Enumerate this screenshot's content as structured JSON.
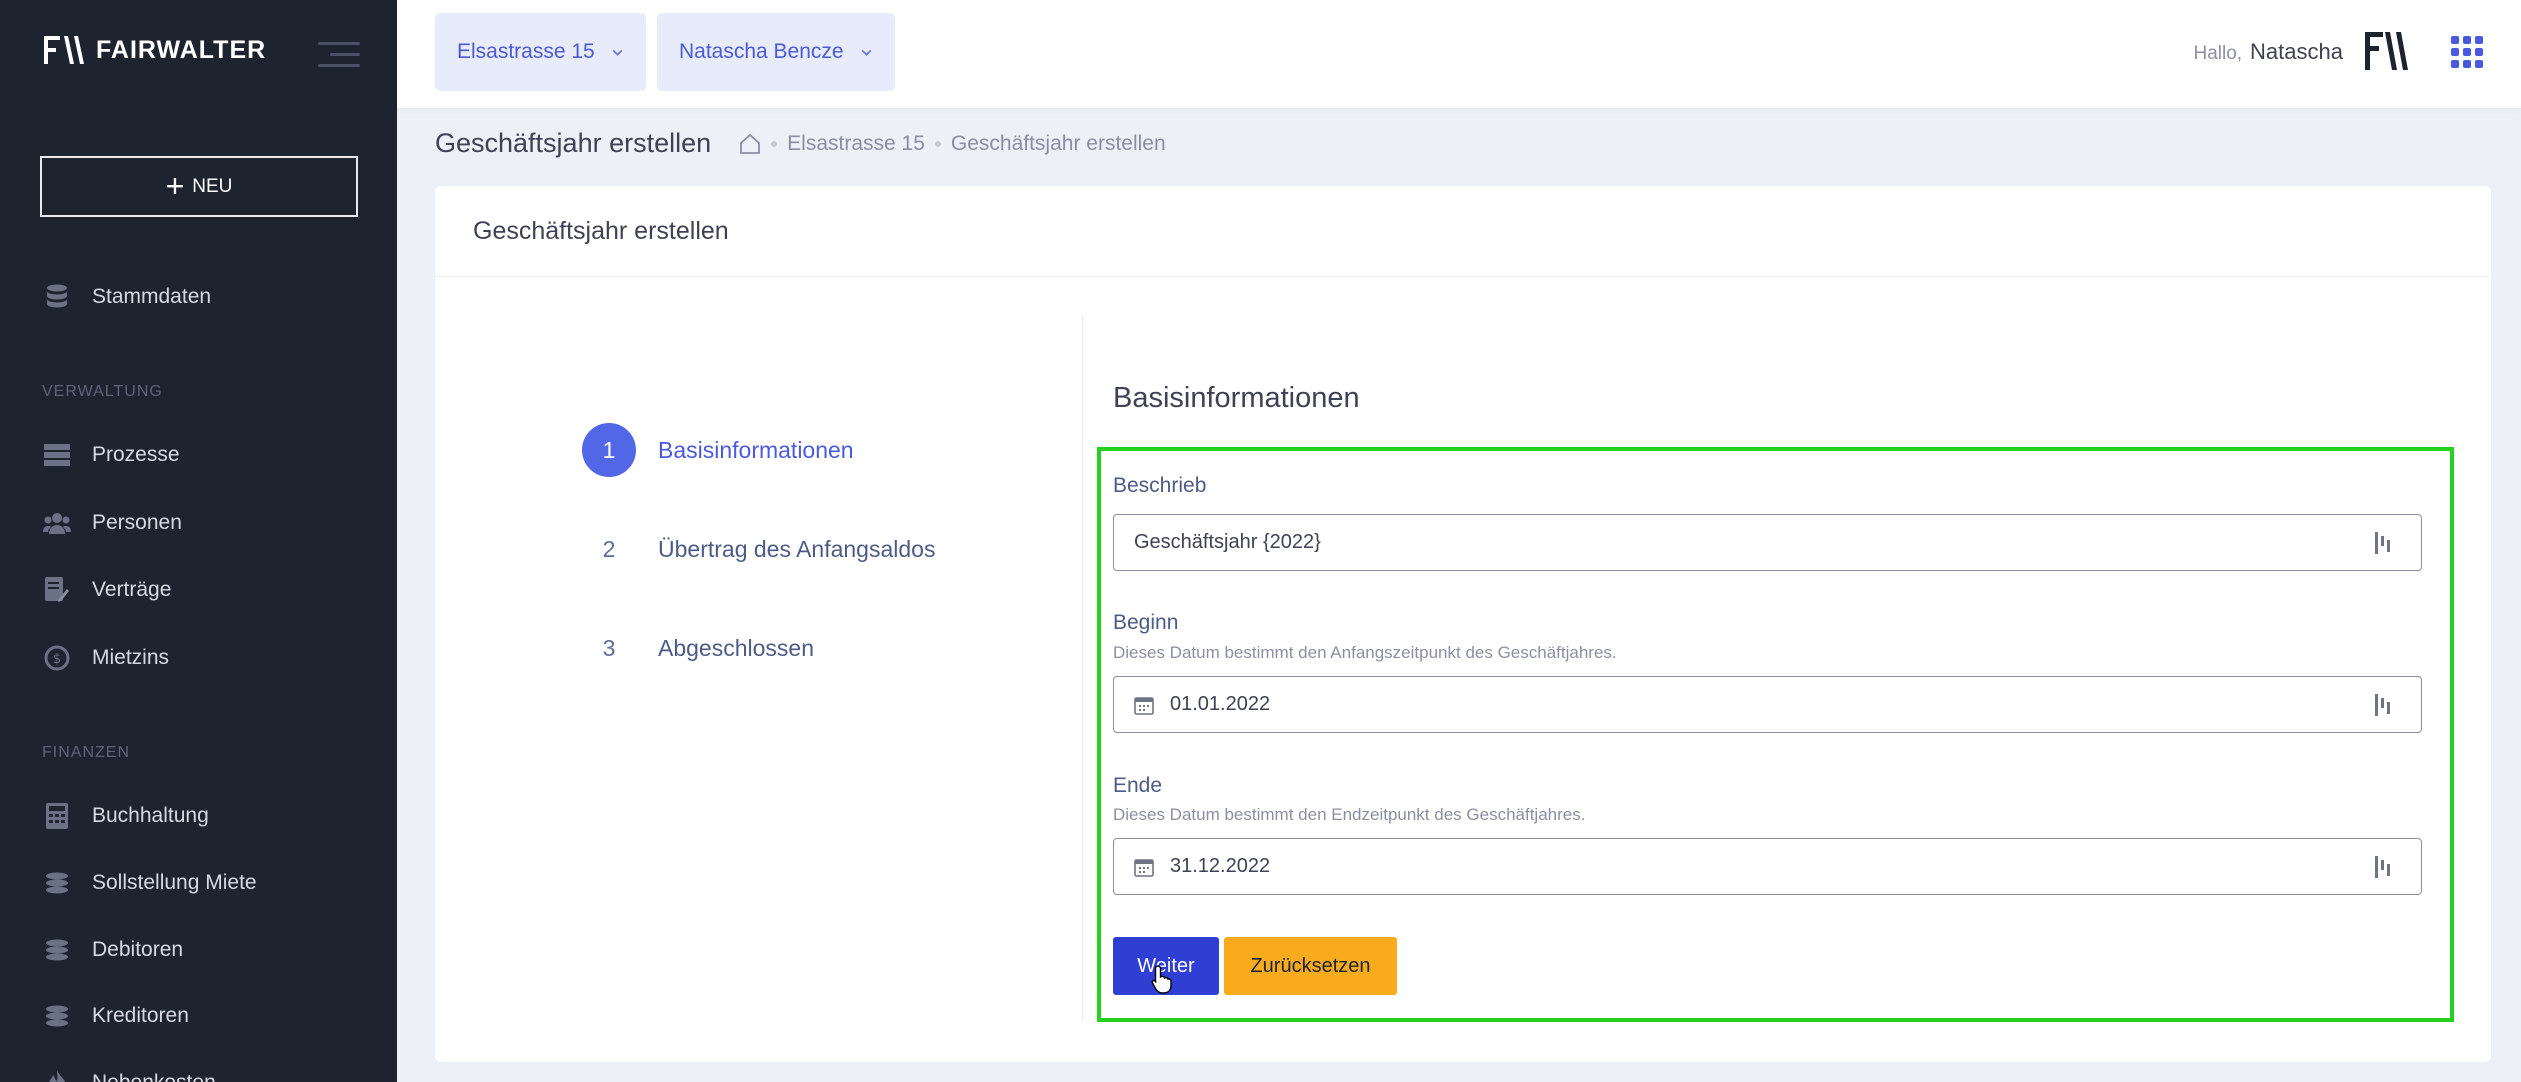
{
  "sidebar": {
    "logo_text": "FAIRWALTER",
    "new_button_label": "NEU",
    "items": [
      {
        "label": "Stammdaten",
        "icon": "database-icon"
      },
      {
        "label": "Prozesse",
        "icon": "server-icon"
      },
      {
        "label": "Personen",
        "icon": "users-icon"
      },
      {
        "label": "Verträge",
        "icon": "contract-icon"
      },
      {
        "label": "Mietzins",
        "icon": "rent-icon"
      },
      {
        "label": "Buchhaltung",
        "icon": "calculator-icon"
      },
      {
        "label": "Sollstellung Miete",
        "icon": "coins-icon"
      },
      {
        "label": "Debitoren",
        "icon": "coins-icon"
      },
      {
        "label": "Kreditoren",
        "icon": "coins-icon"
      },
      {
        "label": "Nebenkosten",
        "icon": "fire-icon"
      }
    ],
    "sections": {
      "verwaltung": "VERWALTUNG",
      "finanzen": "FINANZEN"
    }
  },
  "header": {
    "property": "Elsastrasse 15",
    "person": "Natascha Bencze",
    "hello_prefix": "Hallo,",
    "user_name": "Natascha"
  },
  "subheader": {
    "title": "Geschäftsjahr erstellen",
    "breadcrumbs": [
      "Elsastrasse 15",
      "Geschäftsjahr erstellen"
    ]
  },
  "card": {
    "title": "Geschäftsjahr erstellen",
    "steps": [
      {
        "num": "1",
        "label": "Basisinformationen"
      },
      {
        "num": "2",
        "label": "Übertrag des Anfangsaldos"
      },
      {
        "num": "3",
        "label": "Abgeschlossen"
      }
    ],
    "form_title": "Basisinformationen",
    "fields": {
      "beschrieb": {
        "label": "Beschrieb",
        "value": "Geschäftsjahr {2022}"
      },
      "beginn": {
        "label": "Beginn",
        "help": "Dieses Datum bestimmt den Anfangszeitpunkt des Geschäftjahres.",
        "value": "01.01.2022"
      },
      "ende": {
        "label": "Ende",
        "help": "Dieses Datum bestimmt den Endzeitpunkt des Geschäftjahres.",
        "value": "31.12.2022"
      }
    },
    "buttons": {
      "next": "Weiter",
      "reset": "Zurücksetzen"
    }
  },
  "colors": {
    "sidebar_bg": "#1e2330",
    "accent": "#4a5ae0",
    "primary_button": "#2f3fd4",
    "warning_button": "#f7ab1d",
    "highlight_border": "#23d11e"
  }
}
